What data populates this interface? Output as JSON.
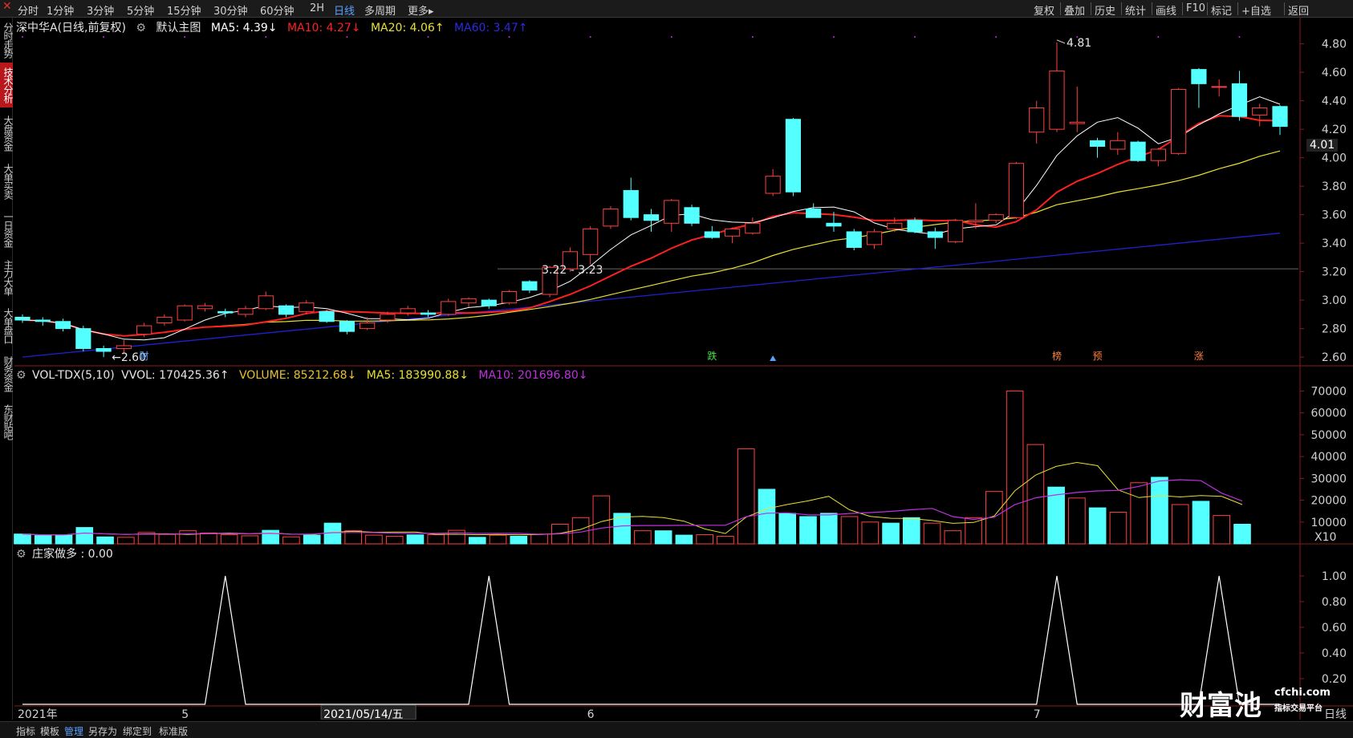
{
  "toolbar": {
    "periods": [
      "分时",
      "1分钟",
      "3分钟",
      "5分钟",
      "15分钟",
      "30分钟",
      "60分钟",
      "2H",
      "日线",
      "多周期",
      "更多▸"
    ],
    "active_period": "日线",
    "right_buttons": [
      "复权",
      "叠加",
      "历史",
      "统计",
      "画线",
      "F10",
      "标记",
      "+自选",
      "返回"
    ]
  },
  "sidebar": {
    "tabs": [
      "分时走势",
      "技术分析",
      "大盘资金",
      "大单买卖",
      "一日资金",
      "主力大单",
      "大单盘口",
      "财务资金",
      "东财贴吧"
    ],
    "active": "技术分析"
  },
  "main_chart": {
    "title": "深中华A(日线,前复权)",
    "template": "默认主图",
    "ma5": "MA5: 4.39↓",
    "ma10": "MA10: 4.27↓",
    "ma20": "MA20: 4.06↑",
    "ma60": "MA60: 3.47↑",
    "high_label": "4.81",
    "low_label": "2.60",
    "range_label": "3.22 - 3.23",
    "current_price": "4.01",
    "price_ticks": [
      "4.80",
      "4.60",
      "4.40",
      "4.20",
      "4.00",
      "3.80",
      "3.60",
      "3.40",
      "3.20",
      "3.00",
      "2.80",
      "2.60"
    ],
    "markers": [
      "财",
      "跌",
      "榜",
      "预",
      "涨"
    ]
  },
  "volume_chart": {
    "name": "VOL-TDX(5,10)",
    "vvol": "VVOL: 170425.36↑",
    "volume": "VOLUME: 85212.68↓",
    "ma5": "MA5: 183990.88↓",
    "ma10": "MA10: 201696.80↓",
    "ticks": [
      "70000",
      "60000",
      "50000",
      "40000",
      "30000",
      "20000",
      "10000"
    ],
    "multiplier": "X10"
  },
  "indicator_chart": {
    "label": "庄家做多 : 0.00",
    "ticks": [
      "1.00",
      "0.80",
      "0.60",
      "0.40",
      "0.20"
    ]
  },
  "date_axis": {
    "labels": [
      "2021年",
      "5",
      "2021/05/14/五",
      "6",
      "7"
    ],
    "period_label": "日线"
  },
  "bottom_tabs": [
    "指标",
    "模板",
    "管理",
    "另存为",
    "绑定到",
    "标准版"
  ],
  "bottom_active": "管理",
  "watermark": {
    "brand": "财富池",
    "site": "cfchi.com",
    "tagline": "指标交易平台"
  },
  "colors": {
    "up": "#ff4040",
    "down": "#54ffff",
    "ma5": "#ffffff",
    "ma10": "#ff2020",
    "ma20": "#e8e030",
    "ma60": "#2020d0",
    "vol_ma5": "#e8e030",
    "vol_ma10": "#c030e0"
  },
  "chart_data": {
    "type": "candlestick",
    "candles": [
      {
        "o": 2.88,
        "c": 2.86,
        "h": 2.9,
        "l": 2.84
      },
      {
        "o": 2.86,
        "c": 2.85,
        "h": 2.88,
        "l": 2.82
      },
      {
        "o": 2.85,
        "c": 2.8,
        "h": 2.87,
        "l": 2.78
      },
      {
        "o": 2.8,
        "c": 2.66,
        "h": 2.82,
        "l": 2.64
      },
      {
        "o": 2.66,
        "c": 2.64,
        "h": 2.68,
        "l": 2.6
      },
      {
        "o": 2.66,
        "c": 2.68,
        "h": 2.72,
        "l": 2.62
      },
      {
        "o": 2.76,
        "c": 2.82,
        "h": 2.84,
        "l": 2.74
      },
      {
        "o": 2.84,
        "c": 2.88,
        "h": 2.9,
        "l": 2.82
      },
      {
        "o": 2.86,
        "c": 2.96,
        "h": 2.97,
        "l": 2.85
      },
      {
        "o": 2.94,
        "c": 2.96,
        "h": 2.98,
        "l": 2.92
      },
      {
        "o": 2.92,
        "c": 2.91,
        "h": 2.94,
        "l": 2.88
      },
      {
        "o": 2.9,
        "c": 2.94,
        "h": 2.96,
        "l": 2.88
      },
      {
        "o": 2.94,
        "c": 3.03,
        "h": 3.06,
        "l": 2.93
      },
      {
        "o": 2.96,
        "c": 2.9,
        "h": 2.97,
        "l": 2.88
      },
      {
        "o": 2.92,
        "c": 2.98,
        "h": 3.0,
        "l": 2.9
      },
      {
        "o": 2.92,
        "c": 2.85,
        "h": 2.93,
        "l": 2.84
      },
      {
        "o": 2.85,
        "c": 2.78,
        "h": 2.86,
        "l": 2.76
      },
      {
        "o": 2.8,
        "c": 2.84,
        "h": 2.88,
        "l": 2.79
      },
      {
        "o": 2.86,
        "c": 2.9,
        "h": 2.92,
        "l": 2.84
      },
      {
        "o": 2.91,
        "c": 2.94,
        "h": 2.96,
        "l": 2.89
      },
      {
        "o": 2.91,
        "c": 2.9,
        "h": 2.93,
        "l": 2.88
      },
      {
        "o": 2.9,
        "c": 2.99,
        "h": 3.01,
        "l": 2.89
      },
      {
        "o": 2.98,
        "c": 3.01,
        "h": 3.02,
        "l": 2.95
      },
      {
        "o": 3.0,
        "c": 2.96,
        "h": 3.01,
        "l": 2.94
      },
      {
        "o": 2.98,
        "c": 3.06,
        "h": 3.07,
        "l": 2.97
      },
      {
        "o": 3.13,
        "c": 3.07,
        "h": 3.14,
        "l": 3.05
      },
      {
        "o": 3.04,
        "c": 3.23,
        "h": 3.24,
        "l": 3.02
      },
      {
        "o": 3.22,
        "c": 3.34,
        "h": 3.37,
        "l": 3.2
      },
      {
        "o": 3.32,
        "c": 3.5,
        "h": 3.52,
        "l": 3.25
      },
      {
        "o": 3.52,
        "c": 3.64,
        "h": 3.66,
        "l": 3.5
      },
      {
        "o": 3.77,
        "c": 3.58,
        "h": 3.86,
        "l": 3.56
      },
      {
        "o": 3.6,
        "c": 3.56,
        "h": 3.64,
        "l": 3.48
      },
      {
        "o": 3.54,
        "c": 3.7,
        "h": 3.71,
        "l": 3.48
      },
      {
        "o": 3.65,
        "c": 3.54,
        "h": 3.67,
        "l": 3.52
      },
      {
        "o": 3.48,
        "c": 3.44,
        "h": 3.52,
        "l": 3.43
      },
      {
        "o": 3.45,
        "c": 3.5,
        "h": 3.51,
        "l": 3.4
      },
      {
        "o": 3.47,
        "c": 3.54,
        "h": 3.58,
        "l": 3.46
      },
      {
        "o": 3.75,
        "c": 3.87,
        "h": 3.92,
        "l": 3.73
      },
      {
        "o": 4.27,
        "c": 3.76,
        "h": 4.28,
        "l": 3.73
      },
      {
        "o": 3.64,
        "c": 3.58,
        "h": 3.68,
        "l": 3.58
      },
      {
        "o": 3.54,
        "c": 3.52,
        "h": 3.62,
        "l": 3.48
      },
      {
        "o": 3.48,
        "c": 3.37,
        "h": 3.5,
        "l": 3.35
      },
      {
        "o": 3.39,
        "c": 3.48,
        "h": 3.5,
        "l": 3.36
      },
      {
        "o": 3.5,
        "c": 3.54,
        "h": 3.58,
        "l": 3.48
      },
      {
        "o": 3.56,
        "c": 3.48,
        "h": 3.58,
        "l": 3.47
      },
      {
        "o": 3.48,
        "c": 3.44,
        "h": 3.51,
        "l": 3.36
      },
      {
        "o": 3.41,
        "c": 3.56,
        "h": 3.57,
        "l": 3.4
      },
      {
        "o": 3.55,
        "c": 3.56,
        "h": 3.68,
        "l": 3.5
      },
      {
        "o": 3.56,
        "c": 3.6,
        "h": 3.61,
        "l": 3.54
      },
      {
        "o": 3.58,
        "c": 3.96,
        "h": 3.97,
        "l": 3.57
      },
      {
        "o": 4.18,
        "c": 4.35,
        "h": 4.4,
        "l": 4.1
      },
      {
        "o": 4.2,
        "c": 4.61,
        "h": 4.81,
        "l": 4.18
      },
      {
        "o": 4.24,
        "c": 4.25,
        "h": 4.5,
        "l": 4.18
      },
      {
        "o": 4.12,
        "c": 4.08,
        "h": 4.14,
        "l": 4.0
      },
      {
        "o": 4.06,
        "c": 4.12,
        "h": 4.18,
        "l": 4.02
      },
      {
        "o": 4.11,
        "c": 3.98,
        "h": 4.12,
        "l": 3.97
      },
      {
        "o": 3.98,
        "c": 4.06,
        "h": 4.07,
        "l": 3.94
      },
      {
        "o": 4.03,
        "c": 4.48,
        "h": 4.49,
        "l": 4.02
      },
      {
        "o": 4.62,
        "c": 4.52,
        "h": 4.63,
        "l": 4.35
      },
      {
        "o": 4.5,
        "c": 4.5,
        "h": 4.55,
        "l": 4.43
      },
      {
        "o": 4.52,
        "c": 4.29,
        "h": 4.61,
        "l": 4.26
      },
      {
        "o": 4.3,
        "c": 4.35,
        "h": 4.38,
        "l": 4.22
      },
      {
        "o": 4.36,
        "c": 4.22,
        "h": 4.37,
        "l": 4.16
      }
    ],
    "volume": [
      4500,
      3800,
      4000,
      7500,
      3200,
      3000,
      5200,
      4300,
      6000,
      5000,
      4200,
      3700,
      6200,
      3200,
      4000,
      9500,
      6000,
      4000,
      3500,
      4100,
      4200,
      6200,
      3000,
      4000,
      3500,
      4500,
      9000,
      12000,
      22000,
      14000,
      6000,
      6000,
      4000,
      4200,
      3500,
      43500,
      25000,
      14000,
      12500,
      14000,
      12500,
      10000,
      9500,
      12000,
      9500,
      6000,
      12000,
      24000,
      70000,
      45500,
      26000,
      21000,
      16500,
      14500,
      28000,
      30500,
      18000,
      19500,
      13000,
      9000
    ],
    "indicator_peaks": [
      10,
      23,
      51,
      59
    ],
    "ylim_price": [
      2.55,
      4.86
    ],
    "ylim_volume": [
      0,
      72000
    ],
    "ylim_indicator": [
      0,
      1.1
    ]
  }
}
